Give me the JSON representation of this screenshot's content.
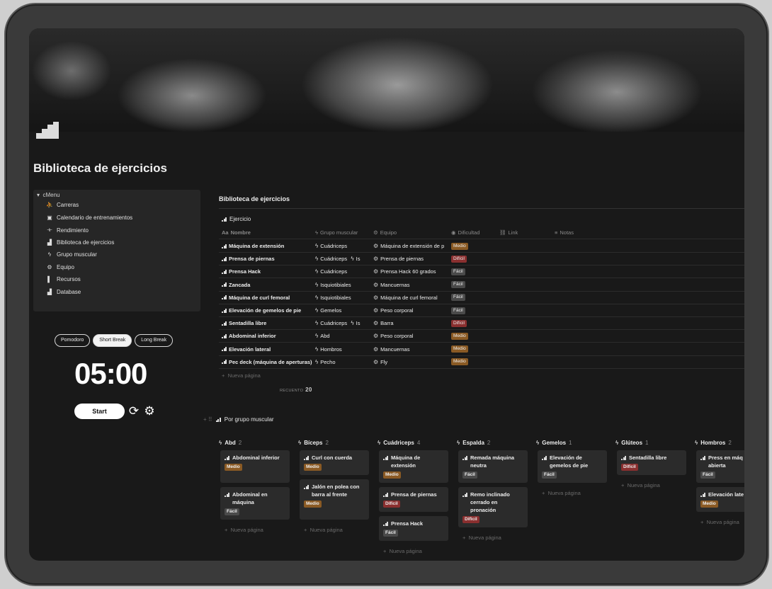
{
  "page": {
    "title": "Biblioteca de ejercicios"
  },
  "menu": {
    "toggle_label": "cMenu",
    "items": [
      {
        "label": "Carreras",
        "icon": "running-icon"
      },
      {
        "label": "Calendario de entrenamientos",
        "icon": "calendar-icon"
      },
      {
        "label": "Rendimiento",
        "icon": "dumbbell-icon"
      },
      {
        "label": "Biblioteca de ejercicios",
        "icon": "bars-icon"
      },
      {
        "label": "Grupo muscular",
        "icon": "bolt-icon"
      },
      {
        "label": "Equipo",
        "icon": "gear-icon"
      },
      {
        "label": "Recursos",
        "icon": "bookmark-icon"
      },
      {
        "label": "Database",
        "icon": "bars-icon"
      }
    ]
  },
  "pomodoro": {
    "tabs": [
      "Pomodoro",
      "Short Break",
      "Long Break"
    ],
    "active_tab": "Short Break",
    "time": "05:00",
    "start_label": "Start"
  },
  "library": {
    "section_title": "Biblioteca de ejercicios",
    "view_label": "Ejercicio",
    "columns": [
      "Nombre",
      "Grupo muscular",
      "Equipo",
      "Dificultad",
      "Link",
      "Notas"
    ],
    "rows": [
      {
        "name": "Máquina de extensión",
        "group": "Cuádriceps",
        "group2": "",
        "equipment": "Máquina de extensión de p",
        "difficulty": "Medio"
      },
      {
        "name": "Prensa de piernas",
        "group": "Cuádriceps",
        "group2": "Is",
        "equipment": "Prensa de piernas",
        "difficulty": "Difícil"
      },
      {
        "name": "Prensa Hack",
        "group": "Cuádriceps",
        "group2": "",
        "equipment": "Prensa Hack 60 grados",
        "difficulty": "Fácil"
      },
      {
        "name": "Zancada",
        "group": "Isquiotibiales",
        "group2": "",
        "equipment": "Mancuernas",
        "difficulty": "Fácil"
      },
      {
        "name": "Máquina de curl femoral",
        "group": "Isquiotibiales",
        "group2": "",
        "equipment": "Máquina de curl femoral",
        "difficulty": "Fácil"
      },
      {
        "name": "Elevación de gemelos de pie",
        "group": "Gemelos",
        "group2": "",
        "equipment": "Peso corporal",
        "difficulty": "Fácil"
      },
      {
        "name": "Sentadilla libre",
        "group": "Cuádriceps",
        "group2": "Is",
        "equipment": "Barra",
        "difficulty": "Difícil"
      },
      {
        "name": "Abdominal inferior",
        "group": "Abd",
        "group2": "",
        "equipment": "Peso corporal",
        "difficulty": "Medio"
      },
      {
        "name": "Elevación lateral",
        "group": "Hombros",
        "group2": "",
        "equipment": "Mancuernas",
        "difficulty": "Medio"
      },
      {
        "name": "Pec deck (máquina de aperturas)",
        "group": "Pecho",
        "group2": "",
        "equipment": "Fly",
        "difficulty": "Medio"
      }
    ],
    "new_page_label": "Nueva página",
    "count_label": "RECUENTO",
    "count_value": "20"
  },
  "board": {
    "title": "Por grupo muscular",
    "new_page_label": "Nueva página",
    "columns": [
      {
        "name": "Abd",
        "count": "2",
        "cards": [
          {
            "title": "Abdominal inferior",
            "tag": "Medio"
          },
          {
            "title": "Abdominal en máquina",
            "tag": "Fácil"
          }
        ]
      },
      {
        "name": "Bíceps",
        "count": "2",
        "cards": [
          {
            "title": "Curl con cuerda",
            "tag": "Medio"
          },
          {
            "title": "Jalón en polea con barra al frente",
            "tag": "Medio"
          }
        ]
      },
      {
        "name": "Cuádriceps",
        "count": "4",
        "cards": [
          {
            "title": "Máquina de extensión",
            "tag": "Medio"
          },
          {
            "title": "Prensa de piernas",
            "tag": "Difícil"
          },
          {
            "title": "Prensa Hack",
            "tag": "Fácil"
          }
        ]
      },
      {
        "name": "Espalda",
        "count": "2",
        "cards": [
          {
            "title": "Remada máquina neutra",
            "tag": "Fácil"
          },
          {
            "title": "Remo inclinado cerrado en pronación",
            "tag": "Difícil"
          }
        ]
      },
      {
        "name": "Gemelos",
        "count": "1",
        "cards": [
          {
            "title": "Elevación de gemelos de pie",
            "tag": "Fácil"
          }
        ]
      },
      {
        "name": "Glúteos",
        "count": "1",
        "cards": [
          {
            "title": "Sentadilla libre",
            "tag": "Difícil"
          }
        ]
      },
      {
        "name": "Hombros",
        "count": "2",
        "cards": [
          {
            "title": "Press en máq abierta",
            "tag": "Fácil"
          },
          {
            "title": "Elevación late",
            "tag": "Medio"
          }
        ]
      }
    ]
  }
}
